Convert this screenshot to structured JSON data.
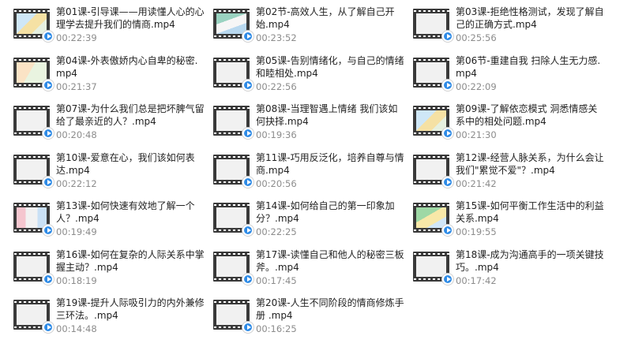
{
  "files": [
    {
      "name": "第01课-引导课——用读懂人心的心理学去提升我们的情商.mp4",
      "duration": "00:22:39",
      "thumb": "c1"
    },
    {
      "name": "第02节-高效人生，从了解自己开始.mp4",
      "duration": "00:23:52",
      "thumb": "c2"
    },
    {
      "name": "第03课-拒绝性格测试，发现了解自己的正确方式.mp4",
      "duration": "00:25:56",
      "thumb": "c0"
    },
    {
      "name": "第04课-外表傲娇内心自卑的秘密.mp4",
      "duration": "00:21:37",
      "thumb": "c3"
    },
    {
      "name": "第05课-告别情绪化，与自己的情绪和睦相处.mp4",
      "duration": "00:22:56",
      "thumb": "c0"
    },
    {
      "name": "第06节-重建自我 扫除人生无力感.mp4",
      "duration": "00:22:09",
      "thumb": "c0"
    },
    {
      "name": "第07课-为什么我们总是把坏脾气留给了最亲近的人？.mp4",
      "duration": "00:20:48",
      "thumb": "c0"
    },
    {
      "name": "第08课-当理智遇上情绪 我们该如何抉择.mp4",
      "duration": "00:19:36",
      "thumb": "c0"
    },
    {
      "name": "第09课-了解依恋模式 洞悉情感关系中的相处问题.mp4",
      "duration": "00:21:30",
      "thumb": "c1"
    },
    {
      "name": "第10课-爱意在心，我们该如何表达.mp4",
      "duration": "00:22:12",
      "thumb": "c0"
    },
    {
      "name": "第11课-巧用反泛化，培养自尊与情商.mp4",
      "duration": "00:20:56",
      "thumb": "c0"
    },
    {
      "name": "第12课-经营人脉关系，为什么会让我们\"累觉不爱\"？.mp4",
      "duration": "00:21:42",
      "thumb": "c0"
    },
    {
      "name": "第13课-如何快速有效地了解一个人？.mp4",
      "duration": "00:19:49",
      "thumb": "c4"
    },
    {
      "name": "第14课-如何给自己的第一印象加分？.mp4",
      "duration": "00:22:25",
      "thumb": "c0"
    },
    {
      "name": "第15课-如何平衡工作生活中的利益关系.mp4",
      "duration": "00:19:55",
      "thumb": "c5"
    },
    {
      "name": "第16课-如何在复杂的人际关系中掌握主动？.mp4",
      "duration": "00:18:19",
      "thumb": "c0"
    },
    {
      "name": "第17课-读懂自己和他人的秘密三板斧。.mp4",
      "duration": "00:17:45",
      "thumb": "c0"
    },
    {
      "name": "第18课-成为沟通高手的一项关键技巧。.mp4",
      "duration": "00:17:42",
      "thumb": "c0"
    },
    {
      "name": "第19课-提升人际吸引力的内外兼修三环法。.mp4",
      "duration": "00:14:48",
      "thumb": "c0"
    },
    {
      "name": "第20课-人生不同阶段的情商修炼手册 .mp4",
      "duration": "00:16:25",
      "thumb": "c0"
    }
  ],
  "icons": {
    "thumbnail": "video-file-icon",
    "badge": "play-badge-icon",
    "badge_color": "#2f8be6"
  }
}
